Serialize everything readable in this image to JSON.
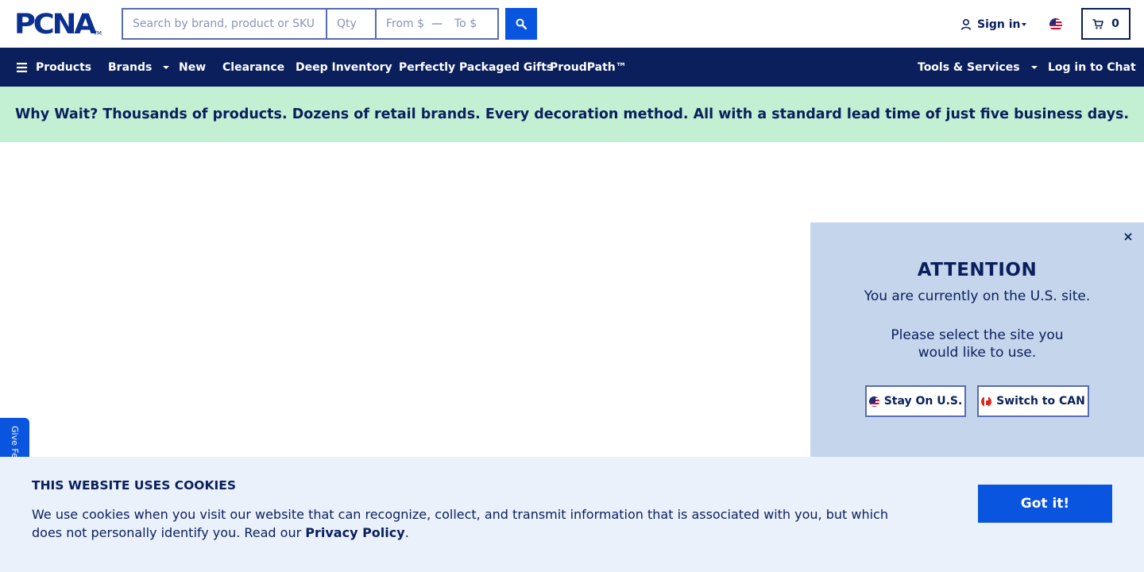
{
  "header": {
    "logo_text": "PCNA",
    "logo_tm": "TM",
    "search": {
      "main_placeholder": "Search by brand, product or SKU",
      "qty_placeholder": "Qty",
      "from_placeholder": "From $",
      "dash": "—",
      "to_placeholder": "To $"
    },
    "signin_label": "Sign in",
    "cart_count": "0"
  },
  "nav": {
    "products": "Products",
    "brands": "Brands",
    "new": "New",
    "clearance": "Clearance",
    "deep_inventory": "Deep Inventory",
    "gifts": "Perfectly Packaged Gifts",
    "proudpath": "ProudPath™",
    "tools": "Tools & Services",
    "chat": "Log in to Chat"
  },
  "promo": {
    "text": "Why Wait? Thousands of products. Dozens of retail brands. Every decoration method. All with a standard lead time of just five business days."
  },
  "attention": {
    "title": "ATTENTION",
    "line1": "You are currently on the U.S. site.",
    "line2": "Please select the site you",
    "line3": "would like to use.",
    "stay_label": "Stay On U.S.",
    "switch_label": "Switch to CAN"
  },
  "feedback": {
    "label": "Give Feedback"
  },
  "cookie": {
    "title": "THIS WEBSITE USES COOKIES",
    "body": "We use cookies when you visit our website that can recognize, collect, and transmit information that is associated with you, but which does not personally identify you. Read our ",
    "link": "Privacy Policy",
    "period": ".",
    "button": "Got it!"
  },
  "colors": {
    "navy": "#0a1f5c",
    "brand_blue": "#0a55e0",
    "promo_green": "#c3efd3",
    "modal_bg": "#c5d5ec",
    "cookie_bg": "#eaf1fb"
  }
}
